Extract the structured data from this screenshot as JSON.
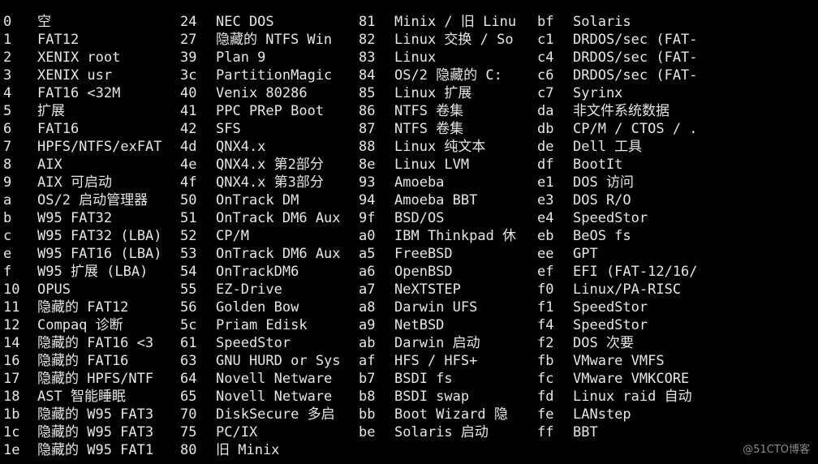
{
  "columns": [
    [
      {
        "code": "0",
        "name": "空"
      },
      {
        "code": "1",
        "name": "FAT12"
      },
      {
        "code": "2",
        "name": "XENIX root"
      },
      {
        "code": "3",
        "name": "XENIX usr"
      },
      {
        "code": "4",
        "name": "FAT16 <32M"
      },
      {
        "code": "5",
        "name": "扩展"
      },
      {
        "code": "6",
        "name": "FAT16"
      },
      {
        "code": "7",
        "name": "HPFS/NTFS/exFAT"
      },
      {
        "code": "8",
        "name": "AIX"
      },
      {
        "code": "9",
        "name": "AIX 可启动"
      },
      {
        "code": "a",
        "name": "OS/2 启动管理器"
      },
      {
        "code": "b",
        "name": "W95 FAT32"
      },
      {
        "code": "c",
        "name": "W95 FAT32 (LBA)"
      },
      {
        "code": "e",
        "name": "W95 FAT16 (LBA)"
      },
      {
        "code": "f",
        "name": "W95 扩展 (LBA)"
      },
      {
        "code": "10",
        "name": "OPUS"
      },
      {
        "code": "11",
        "name": "隐藏的 FAT12"
      },
      {
        "code": "12",
        "name": "Compaq 诊断"
      },
      {
        "code": "14",
        "name": "隐藏的 FAT16 <3"
      },
      {
        "code": "16",
        "name": "隐藏的 FAT16"
      },
      {
        "code": "17",
        "name": "隐藏的 HPFS/NTF"
      },
      {
        "code": "18",
        "name": "AST 智能睡眠"
      },
      {
        "code": "1b",
        "name": "隐藏的 W95 FAT3"
      },
      {
        "code": "1c",
        "name": "隐藏的 W95 FAT3"
      },
      {
        "code": "1e",
        "name": "隐藏的 W95 FAT1"
      }
    ],
    [
      {
        "code": "24",
        "name": "NEC DOS"
      },
      {
        "code": "27",
        "name": "隐藏的 NTFS Win"
      },
      {
        "code": "39",
        "name": "Plan 9"
      },
      {
        "code": "3c",
        "name": "PartitionMagic"
      },
      {
        "code": "40",
        "name": "Venix 80286"
      },
      {
        "code": "41",
        "name": "PPC PReP Boot"
      },
      {
        "code": "42",
        "name": "SFS"
      },
      {
        "code": "4d",
        "name": "QNX4.x"
      },
      {
        "code": "4e",
        "name": "QNX4.x 第2部分"
      },
      {
        "code": "4f",
        "name": "QNX4.x 第3部分"
      },
      {
        "code": "50",
        "name": "OnTrack DM"
      },
      {
        "code": "51",
        "name": "OnTrack DM6 Aux"
      },
      {
        "code": "52",
        "name": "CP/M"
      },
      {
        "code": "53",
        "name": "OnTrack DM6 Aux"
      },
      {
        "code": "54",
        "name": "OnTrackDM6"
      },
      {
        "code": "55",
        "name": "EZ-Drive"
      },
      {
        "code": "56",
        "name": "Golden Bow"
      },
      {
        "code": "5c",
        "name": "Priam Edisk"
      },
      {
        "code": "61",
        "name": "SpeedStor"
      },
      {
        "code": "63",
        "name": "GNU HURD or Sys"
      },
      {
        "code": "64",
        "name": "Novell Netware"
      },
      {
        "code": "65",
        "name": "Novell Netware"
      },
      {
        "code": "70",
        "name": "DiskSecure 多启"
      },
      {
        "code": "75",
        "name": "PC/IX"
      },
      {
        "code": "80",
        "name": "旧 Minix"
      }
    ],
    [
      {
        "code": "81",
        "name": "Minix / 旧 Linu"
      },
      {
        "code": "82",
        "name": "Linux 交换 / So"
      },
      {
        "code": "83",
        "name": "Linux"
      },
      {
        "code": "84",
        "name": "OS/2 隐藏的 C:"
      },
      {
        "code": "85",
        "name": "Linux 扩展"
      },
      {
        "code": "86",
        "name": "NTFS 卷集"
      },
      {
        "code": "87",
        "name": "NTFS 卷集"
      },
      {
        "code": "88",
        "name": "Linux 纯文本"
      },
      {
        "code": "8e",
        "name": "Linux LVM"
      },
      {
        "code": "93",
        "name": "Amoeba"
      },
      {
        "code": "94",
        "name": "Amoeba BBT"
      },
      {
        "code": "9f",
        "name": "BSD/OS"
      },
      {
        "code": "a0",
        "name": "IBM Thinkpad 休"
      },
      {
        "code": "a5",
        "name": "FreeBSD"
      },
      {
        "code": "a6",
        "name": "OpenBSD"
      },
      {
        "code": "a7",
        "name": "NeXTSTEP"
      },
      {
        "code": "a8",
        "name": "Darwin UFS"
      },
      {
        "code": "a9",
        "name": "NetBSD"
      },
      {
        "code": "ab",
        "name": "Darwin 启动"
      },
      {
        "code": "af",
        "name": "HFS / HFS+"
      },
      {
        "code": "b7",
        "name": "BSDI fs"
      },
      {
        "code": "b8",
        "name": "BSDI swap"
      },
      {
        "code": "bb",
        "name": "Boot Wizard 隐"
      },
      {
        "code": "be",
        "name": "Solaris 启动"
      }
    ],
    [
      {
        "code": "bf",
        "name": "Solaris"
      },
      {
        "code": "c1",
        "name": "DRDOS/sec (FAT-"
      },
      {
        "code": "c4",
        "name": "DRDOS/sec (FAT-"
      },
      {
        "code": "c6",
        "name": "DRDOS/sec (FAT-"
      },
      {
        "code": "c7",
        "name": "Syrinx"
      },
      {
        "code": "da",
        "name": "非文件系统数据"
      },
      {
        "code": "db",
        "name": "CP/M / CTOS / ."
      },
      {
        "code": "de",
        "name": "Dell 工具"
      },
      {
        "code": "df",
        "name": "BootIt"
      },
      {
        "code": "e1",
        "name": "DOS 访问"
      },
      {
        "code": "e3",
        "name": "DOS R/O"
      },
      {
        "code": "e4",
        "name": "SpeedStor"
      },
      {
        "code": "eb",
        "name": "BeOS fs"
      },
      {
        "code": "ee",
        "name": "GPT"
      },
      {
        "code": "ef",
        "name": "EFI (FAT-12/16/"
      },
      {
        "code": "f0",
        "name": "Linux/PA-RISC"
      },
      {
        "code": "f1",
        "name": "SpeedStor"
      },
      {
        "code": "f4",
        "name": "SpeedStor"
      },
      {
        "code": "f2",
        "name": "DOS 次要"
      },
      {
        "code": "fb",
        "name": "VMware VMFS"
      },
      {
        "code": "fc",
        "name": "VMware VMKCORE"
      },
      {
        "code": "fd",
        "name": "Linux raid 自动"
      },
      {
        "code": "fe",
        "name": "LANstep"
      },
      {
        "code": "ff",
        "name": "BBT"
      }
    ]
  ],
  "watermark": "@51CTO博客",
  "colors": {
    "background": "#000000",
    "text": "#e6e6e6",
    "watermark": "#8a8a8a"
  }
}
